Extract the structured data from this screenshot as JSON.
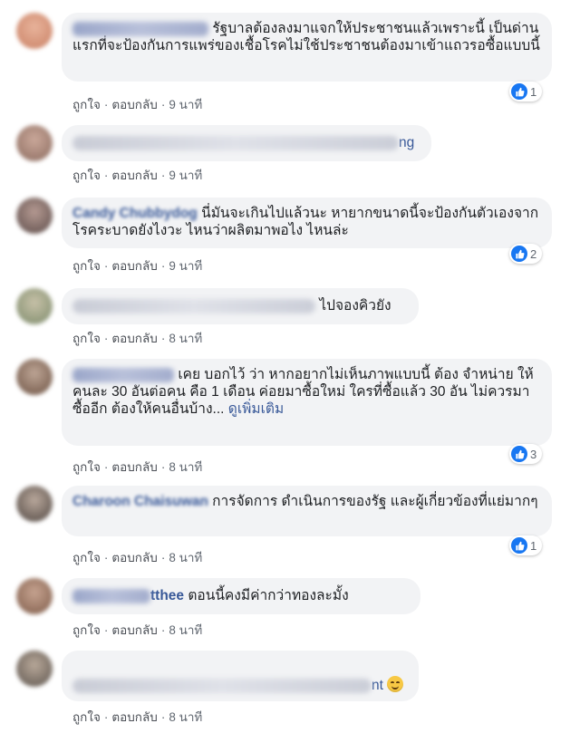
{
  "actions": {
    "like": "ถูกใจ",
    "reply": "ตอบกลับ",
    "separator": "·"
  },
  "comments": [
    {
      "name": "",
      "text": "รัฐบาลต้องลงมาแจกให้ประชาชนแล้วเพราะนี้ เป็นด่านแรกที่จะป้องกันการแพร่ของเชื้อโรคไม่ใช้ประชาชนต้องมาเข้าแถวรอซื้อแบบนี้",
      "time": "9 นาที",
      "likes": "1"
    },
    {
      "name": "",
      "text": "ng",
      "time": "9 นาที",
      "likes": ""
    },
    {
      "name": "Candy Chubbydog",
      "text": "นี่มันจะเกินไปแล้วนะ หายากขนาดนี้จะป้องกันตัวเองจากโรคระบาดยังไงวะ ไหนว่าผลิตมาพอไง ไหนล่ะ",
      "time": "9 นาที",
      "likes": "2"
    },
    {
      "name": "",
      "text": "ไปจองคิวยัง",
      "time": "8 นาที",
      "likes": ""
    },
    {
      "name": "",
      "text": "เคย บอกไว้ ว่า หากอยากไม่เห็นภาพแบบนี้ ต้อง จำหน่าย ให้ คนละ 30 อันต่อคน คือ 1 เดือน ค่อยมาซื้อใหม่ ใครที่ซื้อแล้ว 30 อัน ไม่ควรมาซื้ออีก ต้องให้คนอื่นบ้าง...",
      "see_more": "ดูเพิ่มเติม",
      "time": "8 นาที",
      "likes": "3"
    },
    {
      "name": "Charoon Chaisuwan",
      "text": "การจัดการ ดำเนินการของรัฐ และผู้เกี่ยวข้องที่แย่มากๆ",
      "time": "8 นาที",
      "likes": "1"
    },
    {
      "name": "tthee",
      "text": "ตอนนี้คงมีค่ากว่าทองละมั้ง",
      "time": "8 นาที",
      "likes": ""
    },
    {
      "name": "",
      "text": "nt",
      "time": "8 นาที",
      "likes": ""
    }
  ],
  "colors": {
    "bubble": "#f2f3f5",
    "name": "#385898",
    "like_blue": "#1877f2",
    "meta": "#606770"
  },
  "icons": {
    "like": "thumbs-up-icon",
    "emoji": "smiling-face-icon"
  }
}
